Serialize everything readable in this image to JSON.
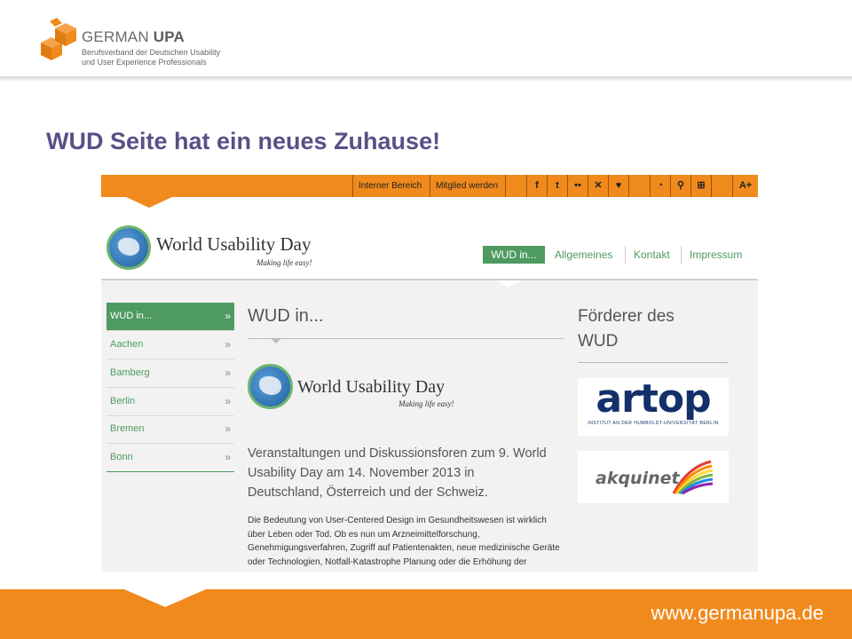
{
  "slide": {
    "org_prefix": "GERMAN ",
    "org_bold": "UPA",
    "org_sub1": "Berufsverband der Deutschen Usability",
    "org_sub2": "und User Experience Professionals",
    "title": "WUD Seite hat ein neues Zuhause!",
    "footer_url": "www.germanupa.de"
  },
  "topbar": {
    "links": [
      "Interner Bereich",
      "Mitglied werden"
    ],
    "icons": [
      {
        "name": "facebook-icon",
        "glyph": "f"
      },
      {
        "name": "twitter-icon",
        "glyph": "t"
      },
      {
        "name": "flickr-icon",
        "glyph": "••"
      },
      {
        "name": "xing-icon",
        "glyph": "✕"
      },
      {
        "name": "heart-icon",
        "glyph": "♥"
      },
      {
        "name": "rss-icon",
        "glyph": "◔"
      },
      {
        "name": "search-icon",
        "glyph": "⚲"
      },
      {
        "name": "sitemap-icon",
        "glyph": "⊞"
      },
      {
        "name": "font-size-icon",
        "glyph": "A+"
      }
    ]
  },
  "site": {
    "logo_title": "World Usability Day",
    "logo_sub": "Making life easy!",
    "nav": [
      "WUD in...",
      "Allgemeines",
      "Kontakt",
      "Impressum"
    ]
  },
  "sidebar": {
    "items": [
      "WUD in...",
      "Aachen",
      "Bamberg",
      "Berlin",
      "Bremen",
      "Bonn"
    ],
    "arrow": "»"
  },
  "main": {
    "heading": "WUD in...",
    "logo_title": "World Usability Day",
    "logo_sub": "Making life easy!",
    "lead": "Veranstaltungen und Diskussionsforen zum 9. World Usability Day am 14. November 2013 in Deutschland, Österreich und der Schweiz.",
    "body": "Die Bedeutung von User-Centered Design im Gesundheitswesen ist wirklich über Leben oder Tod. Ob es nun um Arzneimittelforschung, Genehmigungsverfahren, Zugriff auf Patientenakten, neue medizinische Geräte oder Technologien, Notfall-Katastrophe Planung oder die Erhöhung der"
  },
  "sponsors": {
    "heading": "Förderer des WUD",
    "artop_word": "artop",
    "artop_sub": "INSTITUT AN DER HUMBOLDT-UNIVERSITÄT BERLIN",
    "akquinet_word": "akquinet"
  },
  "colors": {
    "orange": "#f08a1c",
    "green": "#4e9a61",
    "title_purple": "#5b4f86",
    "artop_blue": "#13306b"
  }
}
